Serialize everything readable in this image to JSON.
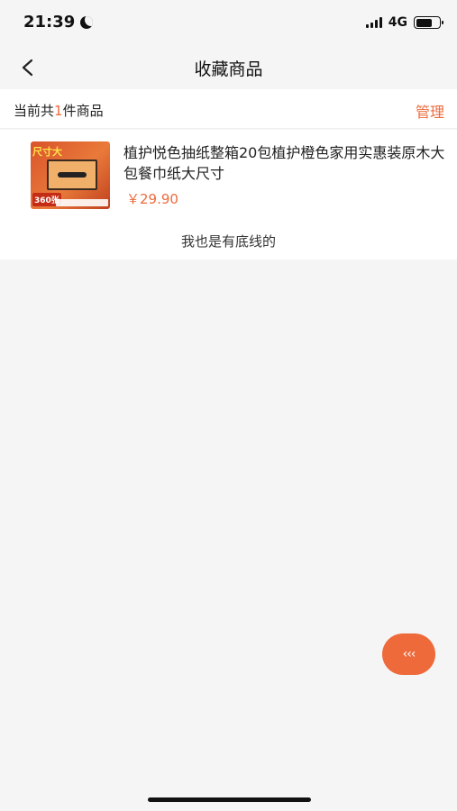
{
  "status_bar": {
    "time": "21:39",
    "network": "4G"
  },
  "nav": {
    "title": "收藏商品"
  },
  "summary": {
    "prefix": "当前共",
    "count": "1",
    "suffix": "件商品",
    "manage_label": "管理"
  },
  "products": [
    {
      "name": "植护悦色抽纸整箱20包植护橙色家用实惠装原木大包餐巾纸大尺寸",
      "price": "￥29.90",
      "thumb_tag": "尺寸大",
      "thumb_badge": "360张"
    }
  ],
  "footer_note": "我也是有底线的",
  "float_button": {
    "label": "‹‹‹"
  },
  "colors": {
    "accent": "#ee6a3b",
    "background": "#f5f5f5"
  }
}
